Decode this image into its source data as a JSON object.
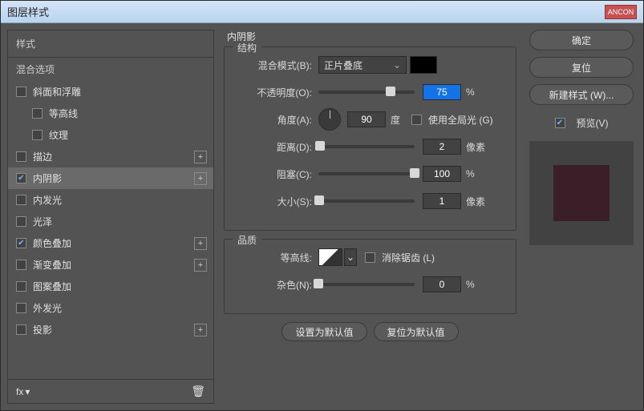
{
  "title": "图层样式",
  "close": "✕",
  "sidebar": {
    "styles_head": "样式",
    "blend_head": "混合选项",
    "items": [
      {
        "label": "斜面和浮雕",
        "checked": false,
        "indent": false,
        "plus": false
      },
      {
        "label": "等高线",
        "checked": false,
        "indent": true,
        "plus": false
      },
      {
        "label": "纹理",
        "checked": false,
        "indent": true,
        "plus": false
      },
      {
        "label": "描边",
        "checked": false,
        "indent": false,
        "plus": true
      },
      {
        "label": "内阴影",
        "checked": true,
        "indent": false,
        "plus": true,
        "selected": true
      },
      {
        "label": "内发光",
        "checked": false,
        "indent": false,
        "plus": false
      },
      {
        "label": "光泽",
        "checked": false,
        "indent": false,
        "plus": false
      },
      {
        "label": "颜色叠加",
        "checked": true,
        "indent": false,
        "plus": true
      },
      {
        "label": "渐变叠加",
        "checked": false,
        "indent": false,
        "plus": true
      },
      {
        "label": "图案叠加",
        "checked": false,
        "indent": false,
        "plus": false
      },
      {
        "label": "外发光",
        "checked": false,
        "indent": false,
        "plus": false
      },
      {
        "label": "投影",
        "checked": false,
        "indent": false,
        "plus": true
      }
    ],
    "fx": "fx"
  },
  "panel": {
    "title": "内阴影",
    "struct": "结构",
    "blend_mode_lbl": "混合模式(B):",
    "blend_mode_val": "正片叠底",
    "opacity_lbl": "不透明度(O):",
    "opacity_val": "75",
    "opacity_unit": "%",
    "opacity_pct": 75,
    "angle_lbl": "角度(A):",
    "angle_val": "90",
    "angle_unit": "度",
    "global_lbl": "使用全局光 (G)",
    "global_checked": false,
    "dist_lbl": "距离(D):",
    "dist_val": "2",
    "dist_unit": "像素",
    "dist_pct": 2,
    "choke_lbl": "阻塞(C):",
    "choke_val": "100",
    "choke_unit": "%",
    "choke_pct": 100,
    "size_lbl": "大小(S):",
    "size_val": "1",
    "size_unit": "像素",
    "size_pct": 1,
    "quality": "品质",
    "contour_lbl": "等高线:",
    "anti_lbl": "消除锯齿 (L)",
    "anti_checked": false,
    "noise_lbl": "杂色(N):",
    "noise_val": "0",
    "noise_unit": "%",
    "noise_pct": 0,
    "default_btn": "设置为默认值",
    "reset_btn": "复位为默认值"
  },
  "right": {
    "ok": "确定",
    "cancel": "复位",
    "new": "新建样式 (W)...",
    "preview_lbl": "预览(V)",
    "preview_checked": true
  }
}
